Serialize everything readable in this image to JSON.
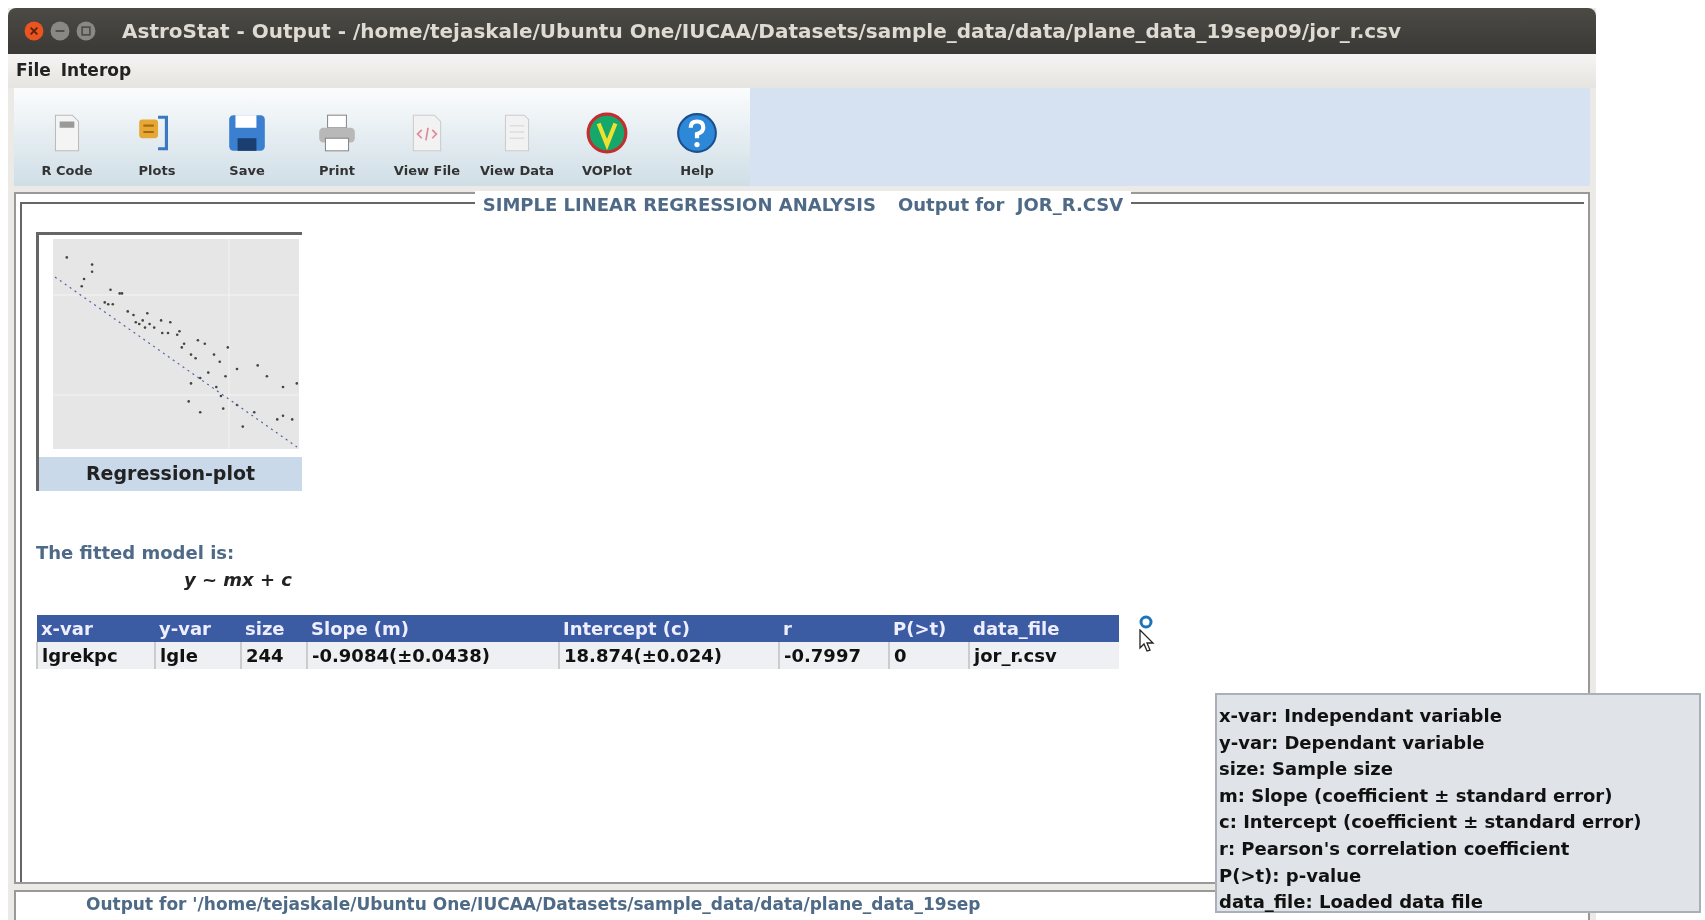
{
  "window": {
    "title": "AstroStat - Output - /home/tejaskale/Ubuntu One/IUCAA/Datasets/sample_data/data/plane_data_19sep09/jor_r.csv",
    "controls": [
      {
        "kind": "close"
      },
      {
        "kind": "minimize"
      },
      {
        "kind": "maximize"
      }
    ]
  },
  "menu": [
    "File",
    "Interop"
  ],
  "toolbar": [
    {
      "label": "R Code",
      "kind": "rcode"
    },
    {
      "label": "Plots",
      "kind": "plots"
    },
    {
      "label": "Save",
      "kind": "save"
    },
    {
      "label": "Print",
      "kind": "print"
    },
    {
      "label": "View File",
      "kind": "viewfile"
    },
    {
      "label": "View Data",
      "kind": "viewdata"
    },
    {
      "label": "VOPlot",
      "kind": "voplot"
    },
    {
      "label": "Help",
      "kind": "help"
    }
  ],
  "panel": {
    "title": "SIMPLE LINEAR REGRESSION ANALYSIS",
    "subtitle": "Output for  JOR_R.CSV"
  },
  "plot": {
    "caption": "Regression-plot"
  },
  "model": {
    "label": "The fitted model is:",
    "formula": "y ~ mx + c"
  },
  "table": {
    "columns": [
      "x-var",
      "y-var",
      "size",
      "Slope (m)",
      "Intercept (c)",
      "r",
      "P(>t)",
      "data_file"
    ],
    "rows": [
      [
        "lgrekpc",
        "lgIe",
        "244",
        "-0.9084(±0.0438)",
        "18.874(±0.024)",
        "-0.7997",
        "0",
        "jor_r.csv"
      ]
    ]
  },
  "status_bar": "Output for '/home/tejaskale/Ubuntu One/IUCAA/Datasets/sample_data/data/plane_data_19sep",
  "tooltip": {
    "lines": [
      "x-var: Independant variable",
      "y-var: Dependant variable",
      "size: Sample size",
      "m: Slope (coefficient ± standard error)",
      "c: Intercept (coefficient ± standard error)",
      "r: Pearson's correlation coefficient",
      "P(>t): p-value",
      "data_file: Loaded data file"
    ]
  }
}
